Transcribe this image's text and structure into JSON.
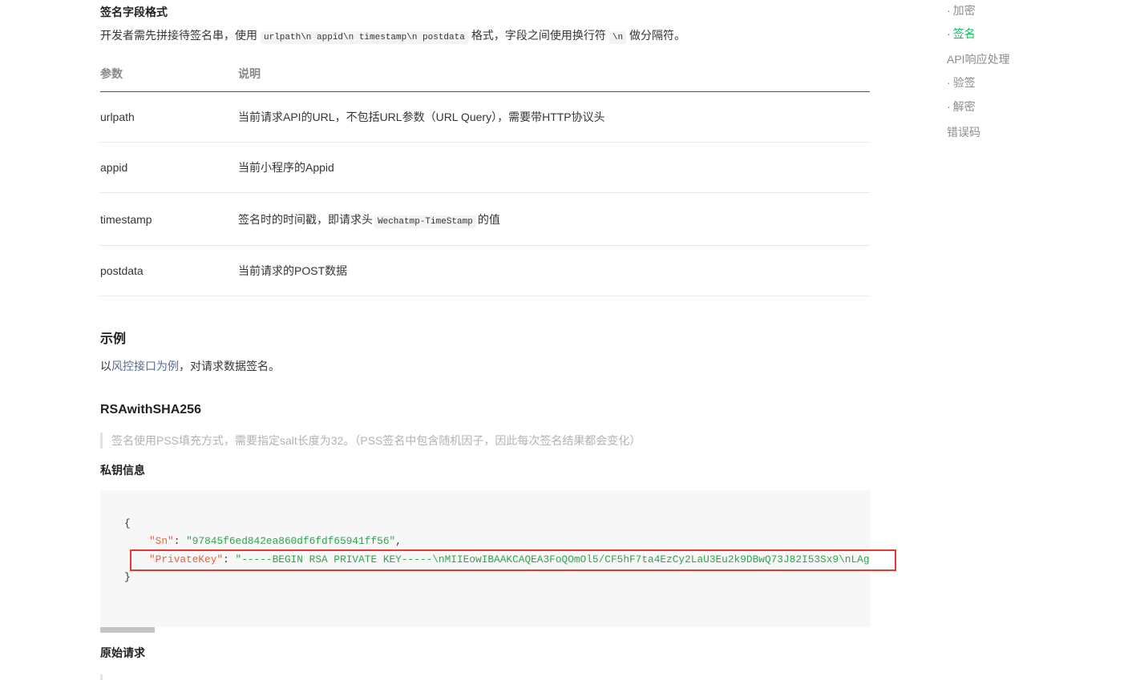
{
  "colors": {
    "accent": "#07c160",
    "link": "#576b95",
    "code_key": "#e8603c",
    "code_string": "#2ea44f",
    "highlight": "#e53935"
  },
  "toc": {
    "bullet": "·",
    "items": [
      {
        "label": "加密",
        "sub": true,
        "active": false
      },
      {
        "label": "签名",
        "sub": true,
        "active": true
      },
      {
        "label": "API响应处理",
        "sub": false,
        "active": false
      },
      {
        "label": "验签",
        "sub": true,
        "active": false
      },
      {
        "label": "解密",
        "sub": true,
        "active": false
      },
      {
        "label": "错误码",
        "sub": false,
        "active": false
      }
    ]
  },
  "sign_format": {
    "title": "签名字段格式",
    "desc_before": "开发者需先拼接待签名串，使用",
    "desc_code": "urlpath\\n appid\\n timestamp\\n postdata",
    "desc_middle": "格式，字段之间使用换行符",
    "desc_code2": "\\n",
    "desc_after": "做分隔符。"
  },
  "params_table": {
    "headers": [
      "参数",
      "说明"
    ],
    "rows": [
      {
        "param": "urlpath",
        "desc": "当前请求API的URL，不包括URL参数（URL Query），需要带HTTP协议头"
      },
      {
        "param": "appid",
        "desc": "当前小程序的Appid"
      },
      {
        "param": "timestamp",
        "desc": "签名时的时间戳，即请求头",
        "desc_code": "Wechatmp-TimeStamp",
        "desc_after": "的值"
      },
      {
        "param": "postdata",
        "desc": "当前请求的POST数据"
      }
    ]
  },
  "example": {
    "title": "示例",
    "text_before": "以",
    "link": "风控接口为例",
    "text_after": "，对请求数据签名。"
  },
  "rsa": {
    "title": "RSAwithSHA256",
    "note": "签名使用PSS填充方式，需要指定salt长度为32。（PSS签名中包含随机因子，因此每次签名结果都会变化）"
  },
  "private_key": {
    "title": "私钥信息",
    "code": {
      "open": "{",
      "close": "}",
      "sep": ": ",
      "entries": [
        {
          "key": "\"Sn\"",
          "value": "\"97845f6ed842ea860df6fdf65941ff56\"",
          "trail": ","
        },
        {
          "key": "\"PrivateKey\"",
          "value": "\"-----BEGIN RSA PRIVATE KEY-----\\nMIIEowIBAAKCAQEA3FoQOmOl5/CF5hF7ta4EzCy2LaU3Eu2k9DBwQ73J82I53Sx9\\nLAg"
        }
      ]
    }
  },
  "raw_request": {
    "title": "原始请求"
  }
}
